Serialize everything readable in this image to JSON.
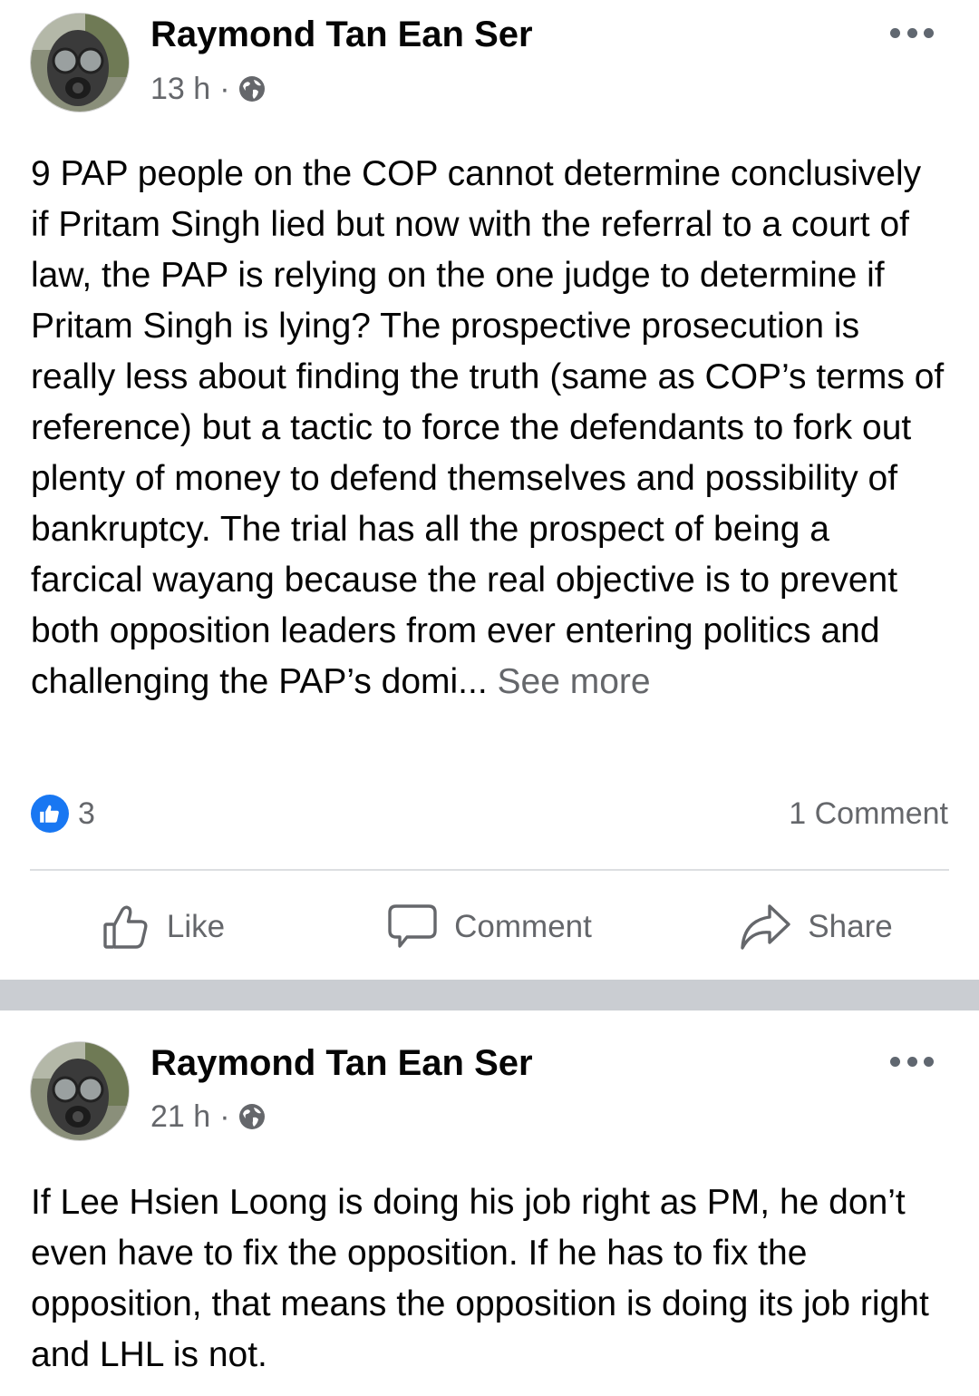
{
  "posts": [
    {
      "author": "Raymond Tan Ean Ser",
      "time": "13 h",
      "separator": "·",
      "privacy_icon": "globe-icon",
      "text": "9 PAP people on the COP cannot determine conclusively if Pritam Singh lied but now with the referral to a court of law, the PAP is relying on the one judge to determine if Pritam Singh is lying? The prospective prosecution is really less about finding the truth (same as COP’s terms of reference) but a tactic to force the defendants to fork out plenty of money to defend themselves and possibility of bankruptcy. The trial has all the prospect of being a farcical wayang because the real objective is to prevent both opposition leaders from ever entering politics and challenging the PAP’s domi...",
      "see_more": "See more",
      "like_count": "3",
      "comment_count": "1 Comment",
      "actions": {
        "like": "Like",
        "comment": "Comment",
        "share": "Share"
      }
    },
    {
      "author": "Raymond Tan Ean Ser",
      "time": "21 h",
      "separator": "·",
      "privacy_icon": "globe-icon",
      "text": "If Lee Hsien Loong is doing his job right as PM, he don’t even have to fix the opposition. If he has to fix the opposition, that means the opposition is doing its job right and LHL is not."
    }
  ],
  "colors": {
    "text": "#050505",
    "secondary": "#65676b",
    "like_blue": "#1877f2",
    "separator": "#cacdd2"
  }
}
